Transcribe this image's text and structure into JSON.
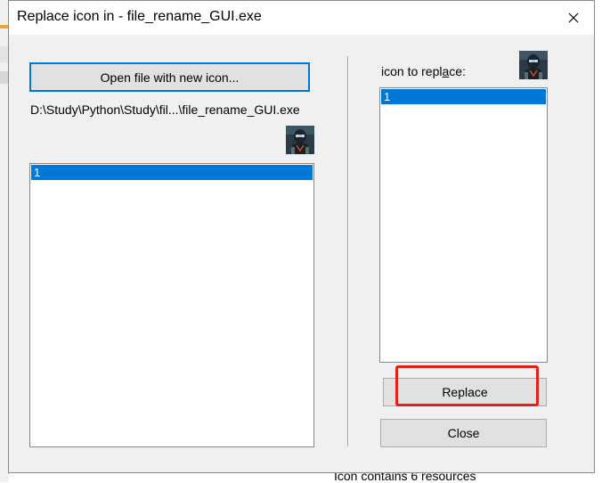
{
  "dialog": {
    "title": "Replace icon in - file_rename_GUI.exe",
    "close_glyph": "✕"
  },
  "left": {
    "open_button_label": "Open file with new icon...",
    "file_path": "D:\\Study\\Python\\Study\\fil...\\file_rename_GUI.exe",
    "preview_icon": "robot-portrait-icon",
    "list_items": [
      "1"
    ]
  },
  "right": {
    "label_prefix": "icon to repl",
    "label_underlined": "a",
    "label_suffix": "ce:",
    "preview_icon": "robot-portrait-icon",
    "list_items": [
      "1"
    ],
    "replace_button_label": "Replace",
    "close_button_label": "Close"
  },
  "background": {
    "status_text": "Icon contains 6 resources"
  },
  "colors": {
    "selection": "#0078d7",
    "highlight": "#e5201a",
    "dialog_bg": "#f0f0f0"
  }
}
